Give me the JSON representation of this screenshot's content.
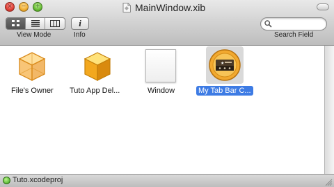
{
  "window": {
    "title": "MainWindow.xib"
  },
  "toolbar": {
    "view_mode_label": "View Mode",
    "info_label": "Info",
    "info_button_text": "i",
    "search_label": "Search Field",
    "search_placeholder": "",
    "active_view_mode": "icon",
    "view_modes": [
      "icon-view-icon",
      "list-view-icon",
      "column-view-icon"
    ]
  },
  "items": [
    {
      "label": "File's Owner",
      "icon": "files-owner-cube-icon",
      "selected": false
    },
    {
      "label": "Tuto App Del...",
      "icon": "app-delegate-cube-icon",
      "selected": false
    },
    {
      "label": "Window",
      "icon": "window-icon",
      "selected": false
    },
    {
      "label": "My Tab Bar C...",
      "icon": "tab-bar-controller-icon",
      "selected": true
    }
  ],
  "status": {
    "project": "Tuto.xcodeproj",
    "indicator_color": "#4caf27"
  },
  "colors": {
    "selection": "#3d7be4"
  }
}
